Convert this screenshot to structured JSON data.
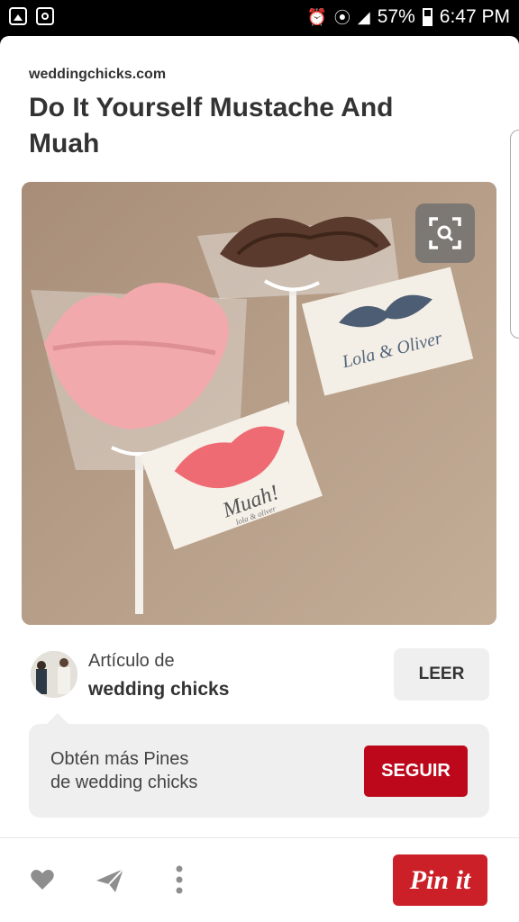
{
  "status_bar": {
    "battery": "57%",
    "time": "6:47 PM",
    "left_icons": [
      "gallery-icon",
      "instagram-icon"
    ],
    "right_icons": [
      "alarm-icon",
      "wifi-icon",
      "signal-icon",
      "battery-icon"
    ]
  },
  "pin": {
    "source": "weddingchicks.com",
    "title": "Do It Yourself Mustache And Muah",
    "image_lettering": [
      "Muah!",
      "lola & oliver",
      "Lola & Oliver"
    ]
  },
  "article": {
    "label": "Artículo de",
    "source_name": "wedding chicks",
    "read_button": "LEER"
  },
  "follow": {
    "line1": "Obtén más Pines",
    "line2": "de wedding chicks",
    "follow_button": "SEGUIR"
  },
  "actions": {
    "icons": [
      "heart-icon",
      "send-icon",
      "more-icon"
    ],
    "pin_button": "Pin it"
  },
  "colors": {
    "pinterest_red": "#bd081c",
    "pin_it_red": "#cb2027",
    "button_grey": "#efefef"
  }
}
